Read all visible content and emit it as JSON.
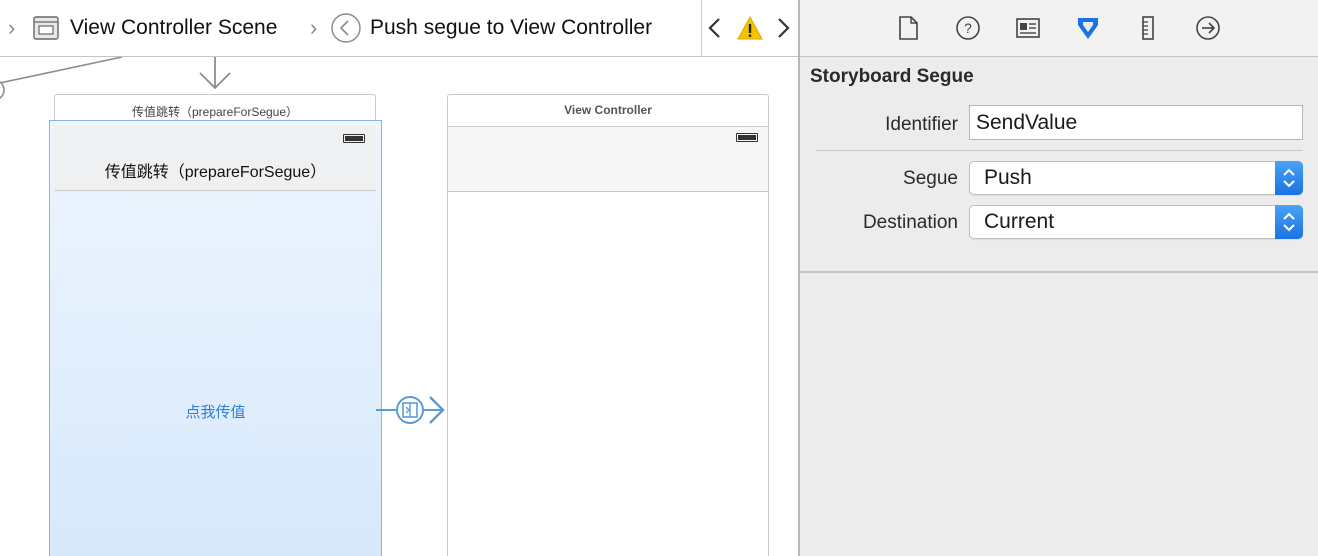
{
  "jumpbar": {
    "scene_label": "View Controller Scene",
    "segue_label": "Push segue to View Controller"
  },
  "canvas": {
    "source_scene": {
      "title": "传值跳转（prepareForSegue）",
      "nav_title": "传值跳转（prepareForSegue）",
      "button_label": "点我传值"
    },
    "dest_scene": {
      "title": "View Controller"
    }
  },
  "inspector": {
    "tabs": [
      "file-icon",
      "help-icon",
      "identity-icon",
      "attributes-icon",
      "size-icon",
      "connections-icon"
    ],
    "section_title": "Storyboard Segue",
    "identifier_label": "Identifier",
    "identifier_value": "SendValue",
    "segue_label": "Segue",
    "segue_value": "Push",
    "destination_label": "Destination",
    "destination_value": "Current"
  },
  "colors": {
    "accent": "#1a73e0",
    "segue_line": "#5b9bd5",
    "warning": "#f5c400",
    "source_fill_top": "#eef5fd",
    "source_fill_bottom": "#d6e8fb"
  }
}
